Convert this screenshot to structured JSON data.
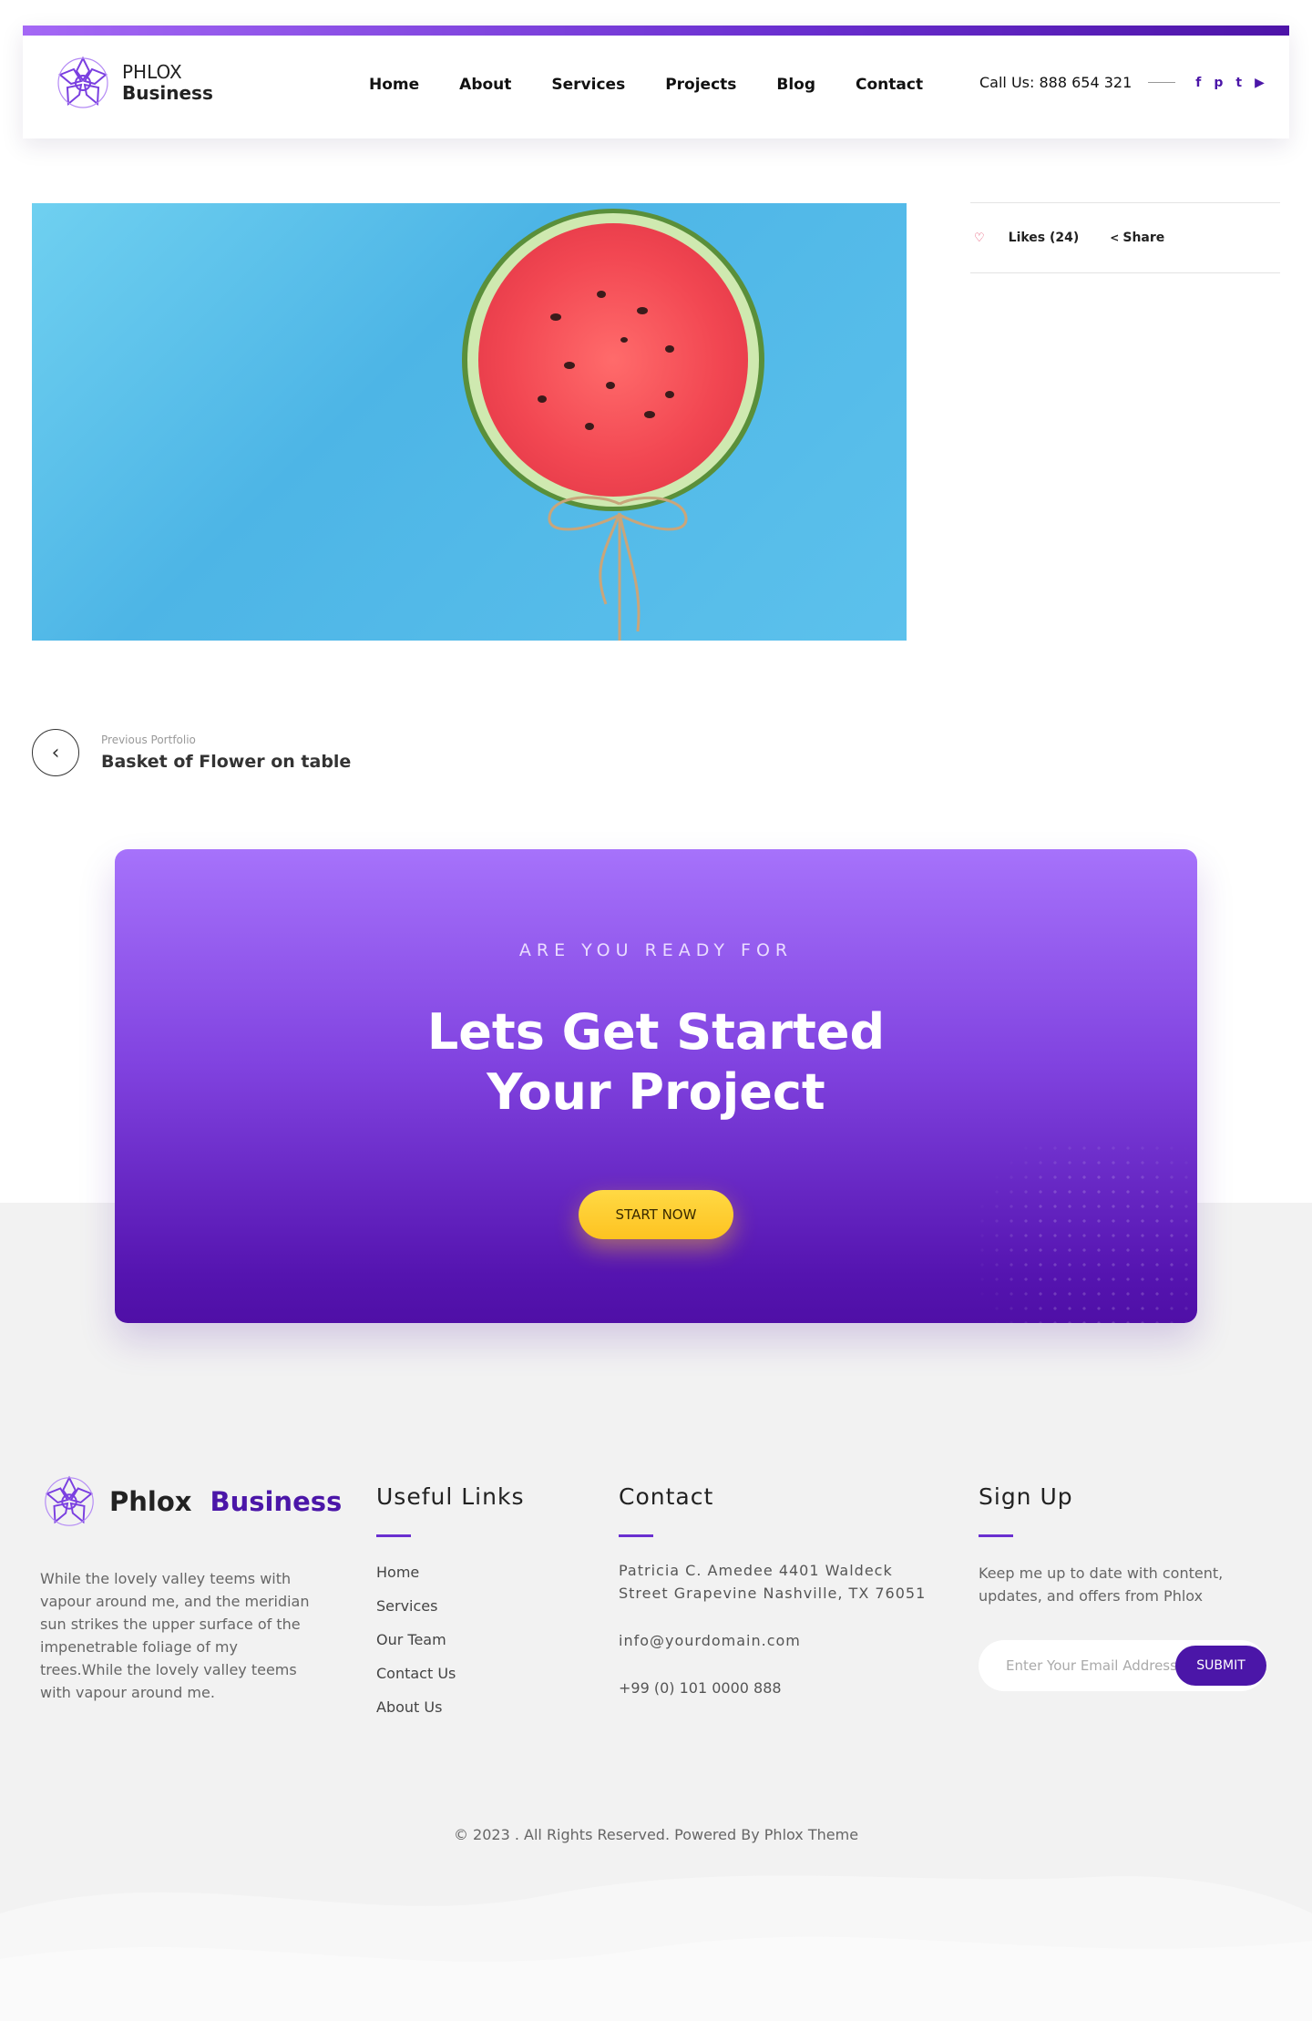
{
  "header": {
    "logo_line1": "PHLOX",
    "logo_line2": "Business",
    "nav": [
      "Home",
      "About",
      "Services",
      "Projects",
      "Blog",
      "Contact"
    ],
    "call_label": "Call Us: 888 654 321",
    "social_icons": [
      "facebook-icon",
      "pinterest-icon",
      "twitter-icon",
      "youtube-icon"
    ]
  },
  "meta": {
    "likes_label": "Likes (24)",
    "share_label": "Share"
  },
  "previous": {
    "small_label": "Previous Portfolio",
    "title": "Basket of Flower on table"
  },
  "cta": {
    "eyebrow": "ARE YOU READY FOR",
    "title_line1": "Lets Get Started",
    "title_line2": "Your Project",
    "button_label": "START NOW"
  },
  "footer": {
    "logo_part1": "Phlox",
    "logo_part2": "Business",
    "about": "While the lovely valley teems with vapour around me, and the meridian sun strikes the upper surface of the impenetrable foliage of my trees.While the lovely valley teems with vapour around me.",
    "links_title": "Useful Links",
    "links": [
      "Home",
      "Services",
      "Our Team",
      "Contact Us",
      "About Us"
    ],
    "contact_title": "Contact",
    "address": "Patricia C. Amedee 4401 Waldeck Street Grapevine Nashville, TX 76051",
    "email": "info@yourdomain.com",
    "phone": "+99 (0) 101 0000 888",
    "signup_title": "Sign Up",
    "signup_text": "Keep me up to date with content, updates, and offers from Phlox",
    "email_placeholder": "Enter Your Email Address",
    "submit_label": "SUBMIT",
    "copyright": "© 2023 . All Rights Reserved. Powered By Phlox Theme"
  },
  "colors": {
    "brand": "#4b16a8",
    "accent": "#a672fb",
    "cta_button": "#fdc321",
    "hero_bg": "#5cc1ec"
  }
}
